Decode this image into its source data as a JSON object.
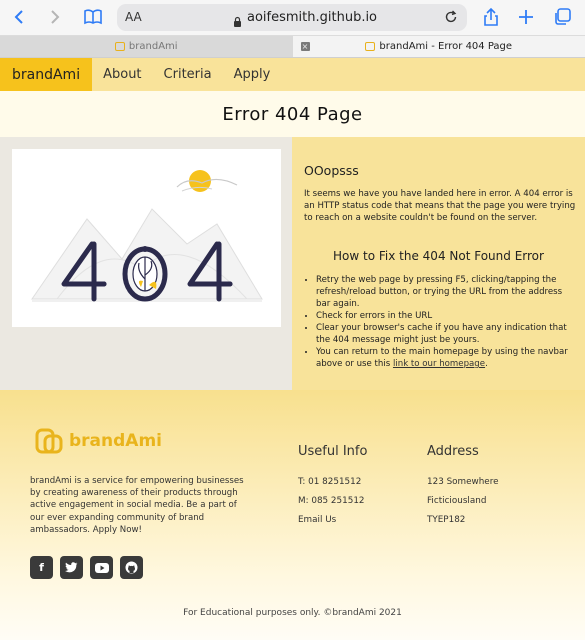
{
  "browser": {
    "text_size_label": "AA",
    "host": "aoifesmith.github.io",
    "tabs": [
      {
        "label": "brandAmi"
      },
      {
        "label": "brandAmi - Error 404 Page"
      }
    ]
  },
  "nav": {
    "brand": "brandAmi",
    "links": [
      "About",
      "Criteria",
      "Apply"
    ]
  },
  "page_title": "Error 404 Page",
  "illustration": {
    "digits": "404"
  },
  "content": {
    "heading": "OOopsss",
    "intro": "It seems we have you have landed here in error. A 404 error is an HTTP status code that means that the page you were trying to reach on a website couldn't be found on the server.",
    "fix_heading": "How to Fix the 404 Not Found Error",
    "fix_items": [
      "Retry the web page by pressing F5, clicking/tapping the refresh/reload button, or trying the URL from the address bar again.",
      "Check for errors in the URL",
      "Clear your browser's cache if you have any indication that the 404 message might just be yours."
    ],
    "last_item_prefix": "You can return to the main homepage by using the navbar above or use this ",
    "homepage_link": "link to our homepage",
    "last_item_suffix": "."
  },
  "footer": {
    "brand": "brandAmi",
    "description": "brandAmi is a service for empowering businesses by creating awareness of their products through active engagement in social media. Be a part of our ever expanding community of brand ambassadors. Apply Now!",
    "social_icons": [
      "facebook-icon",
      "twitter-icon",
      "youtube-icon",
      "github-icon"
    ],
    "useful_heading": "Useful Info",
    "phone": "T: 01 8251512",
    "mobile": "M: 085 251512",
    "email": "Email Us",
    "address_heading": "Address",
    "address_lines": [
      "123 Somewhere",
      "Ficticiousland",
      "TYEP182"
    ],
    "copyright": "For Educational purposes only. ©brandAmi 2021"
  },
  "colors": {
    "brand_yellow": "#f6c21c",
    "nav_bg": "#f9e39a",
    "accent_dark": "#2b2a4c"
  }
}
